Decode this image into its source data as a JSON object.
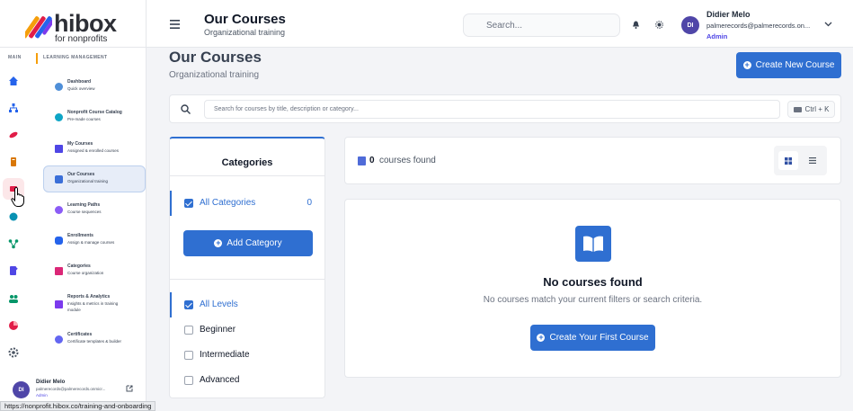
{
  "brand": {
    "name": "hibox",
    "tagline": "for nonprofits"
  },
  "sidebar": {
    "rail_label": "MAIN",
    "menu_heading": "LEARNING MANAGEMENT",
    "rail_icons": [
      {
        "icon": "home-icon",
        "color": "#2563eb"
      },
      {
        "icon": "sitemap-icon",
        "color": "#2563eb"
      },
      {
        "icon": "rocket-icon",
        "color": "#e11d48"
      },
      {
        "icon": "book-icon",
        "color": "#d97706"
      },
      {
        "icon": "graduation-icon",
        "color": "#e11d48"
      },
      {
        "icon": "circle-icon",
        "color": "#0891b2"
      },
      {
        "icon": "network-icon",
        "color": "#059669"
      },
      {
        "icon": "document-icon",
        "color": "#4f46e5"
      },
      {
        "icon": "users-icon",
        "color": "#059669"
      },
      {
        "icon": "pie-chart-icon",
        "color": "#e11d48"
      },
      {
        "icon": "gear-icon",
        "color": "#4b5563"
      }
    ],
    "items": [
      {
        "title": "Dashboard",
        "subtitle": "Quick overview",
        "color": "#4f8fd8"
      },
      {
        "title": "Nonprofit Course Catalog",
        "subtitle": "Pre-made courses",
        "color": "#0ea5c6"
      },
      {
        "title": "My Courses",
        "subtitle": "Assigned & enrolled courses",
        "color": "#4f46e5"
      },
      {
        "title": "Our Courses",
        "subtitle": "Organizational training",
        "color": "#3b6fd8"
      },
      {
        "title": "Learning Paths",
        "subtitle": "Course sequences",
        "color": "#8b5cf6"
      },
      {
        "title": "Enrollments",
        "subtitle": "Assign & manage courses",
        "color": "#2563eb"
      },
      {
        "title": "Categories",
        "subtitle": "Course organization",
        "color": "#db2777"
      },
      {
        "title": "Reports & Analytics",
        "subtitle": "Insights & metrics in training",
        "subtitle2": "module",
        "color": "#7c3aed"
      },
      {
        "title": "Certificates",
        "subtitle": "Certificate templates & builder",
        "color": "#6366f1"
      }
    ],
    "user": {
      "initials": "DI",
      "name": "Didier Melo",
      "email": "palmerecords@palmerecords.onmicr...",
      "role": "Admin"
    }
  },
  "status_url": "https://nonprofit.hibox.co/training-and-onboarding",
  "topbar": {
    "title": "Our Courses",
    "subtitle": "Organizational training",
    "search_placeholder": "Search...",
    "user": {
      "initials": "DI",
      "name": "Didier Melo",
      "email": "palmerecords@palmerecords.on...",
      "role": "Admin"
    }
  },
  "main": {
    "title": "Our Courses",
    "subtitle": "Organizational training",
    "create_button": "Create New Course",
    "search_placeholder": "Search for courses by title, description or category...",
    "shortcut": "Ctrl + K"
  },
  "categories": {
    "title": "Categories",
    "all_label": "All Categories",
    "all_count": "0",
    "add_button": "Add Category",
    "levels": [
      {
        "label": "All Levels",
        "checked": true
      },
      {
        "label": "Beginner",
        "checked": false
      },
      {
        "label": "Intermediate",
        "checked": false
      },
      {
        "label": "Advanced",
        "checked": false
      }
    ]
  },
  "results": {
    "count": "0",
    "label": "courses found"
  },
  "empty": {
    "title": "No courses found",
    "subtitle": "No courses match your current filters or search criteria.",
    "button": "Create Your First Course"
  },
  "colors": {
    "primary": "#2f6fd1",
    "admin": "#4f46e5"
  }
}
